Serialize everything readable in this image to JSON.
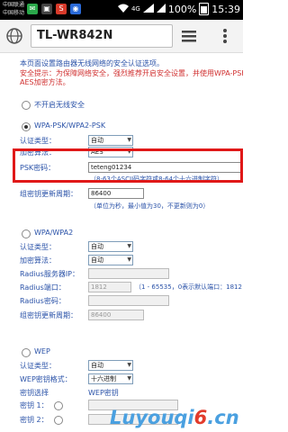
{
  "status_bar": {
    "carrier_1": "中国联通",
    "carrier_2": "中国移动",
    "signal_text": "4G",
    "battery_pct": "100%",
    "time": "15:39"
  },
  "browser": {
    "url": "TL-WR842N"
  },
  "intro": {
    "line1": "本页面设置路由器无线网络的安全认证选项。",
    "line2": "安全提示：为保障网络安全，强烈推荐开启安全设置，并使用WPA-PSK",
    "line3": "AES加密方法。"
  },
  "security": {
    "none_label": "不开启无线安全",
    "wpa_psk": {
      "label": "WPA-PSK/WPA2-PSK",
      "auth_label": "认证类型：",
      "auth_value": "自动",
      "enc_label": "加密算法：",
      "enc_value": "AES",
      "psk_label": "PSK密码：",
      "psk_value": "teteng01234",
      "psk_hint": "（8-63个ASCII码字符或8-64个十六进制字符）",
      "rekey_label": "组密钥更新周期：",
      "rekey_value": "86400",
      "rekey_hint": "（单位为秒，最小值为30，不更新则为0）"
    },
    "wpa": {
      "label": "WPA/WPA2",
      "auth_label": "认证类型：",
      "auth_value": "自动",
      "enc_label": "加密算法：",
      "enc_value": "自动",
      "radius_ip_label": "Radius服务器IP：",
      "radius_port_label": "Radius端口：",
      "radius_port_value": "1812",
      "radius_port_hint": "（1 - 65535，0表示默认端口：1812",
      "radius_pwd_label": "Radius密码：",
      "rekey_label": "组密钥更新周期：",
      "rekey_value": "86400"
    },
    "wep": {
      "label": "WEP",
      "auth_label": "认证类型：",
      "auth_value": "自动",
      "format_label": "WEP密钥格式：",
      "format_value": "十六进制",
      "key_select_label": "密钥选择",
      "wep_key_header": "WEP密钥",
      "key1_label": "密钥 1：",
      "key2_label": "密钥 2："
    }
  },
  "watermark": {
    "part1": "Luyouqi",
    "part2": "6",
    "part3": ".cn"
  }
}
